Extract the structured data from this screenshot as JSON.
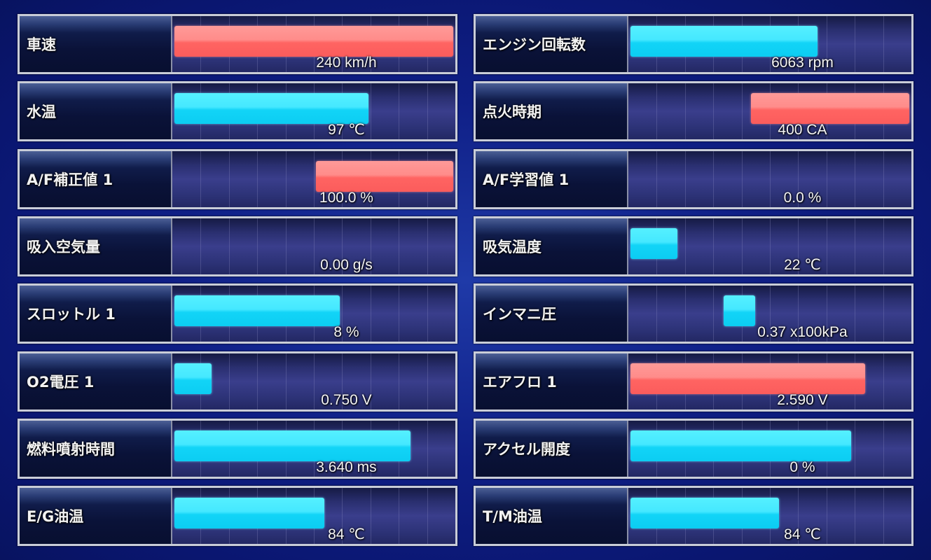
{
  "colors": {
    "cyan_bar": "#2ee0fb",
    "red_bar": "#ff7674",
    "background": "#0f1f86"
  },
  "gauges": {
    "left": [
      {
        "label": "車速",
        "value": "240 km/h",
        "color": "red",
        "fill_start": 0.0,
        "fill_end": 1.0
      },
      {
        "label": "水温",
        "value": "97 ℃",
        "color": "cyan",
        "fill_start": 0.0,
        "fill_end": 0.7
      },
      {
        "label": "A/F補正値 1",
        "value": "100.0 %",
        "color": "red",
        "fill_start": 0.5,
        "fill_end": 1.0
      },
      {
        "label": "吸入空気量",
        "value": "0.00 g/s",
        "color": "none",
        "fill_start": 0.0,
        "fill_end": 0.0
      },
      {
        "label": "スロットル 1",
        "value": "8 %",
        "color": "cyan",
        "fill_start": 0.0,
        "fill_end": 0.6
      },
      {
        "label": "O2電圧 1",
        "value": "0.750 V",
        "color": "cyan",
        "fill_start": 0.0,
        "fill_end": 0.145
      },
      {
        "label": "燃料噴射時間",
        "value": "3.640 ms",
        "color": "cyan",
        "fill_start": 0.0,
        "fill_end": 0.85
      },
      {
        "label": "E/G油温",
        "value": "84 ℃",
        "color": "cyan",
        "fill_start": 0.0,
        "fill_end": 0.545
      }
    ],
    "right": [
      {
        "label": "エンジン回転数",
        "value": "6063 rpm",
        "color": "cyan",
        "fill_start": 0.0,
        "fill_end": 0.675
      },
      {
        "label": "点火時期",
        "value": "400 CA",
        "color": "red",
        "fill_start": 0.425,
        "fill_end": 1.0
      },
      {
        "label": "A/F学習値 1",
        "value": "0.0 %",
        "color": "none",
        "fill_start": 0.0,
        "fill_end": 0.0
      },
      {
        "label": "吸気温度",
        "value": "22 ℃",
        "color": "cyan",
        "fill_start": 0.0,
        "fill_end": 0.18
      },
      {
        "label": "インマニ圧",
        "value": "0.37 x100kPa",
        "color": "cyan",
        "fill_start": 0.33,
        "fill_end": 0.455
      },
      {
        "label": "エアフロ 1",
        "value": "2.590 V",
        "color": "red",
        "fill_start": 0.0,
        "fill_end": 0.845
      },
      {
        "label": "アクセル開度",
        "value": "0 %",
        "color": "cyan",
        "fill_start": 0.0,
        "fill_end": 0.795
      },
      {
        "label": "T/M油温",
        "value": "84 ℃",
        "color": "cyan",
        "fill_start": 0.0,
        "fill_end": 0.54
      }
    ]
  }
}
